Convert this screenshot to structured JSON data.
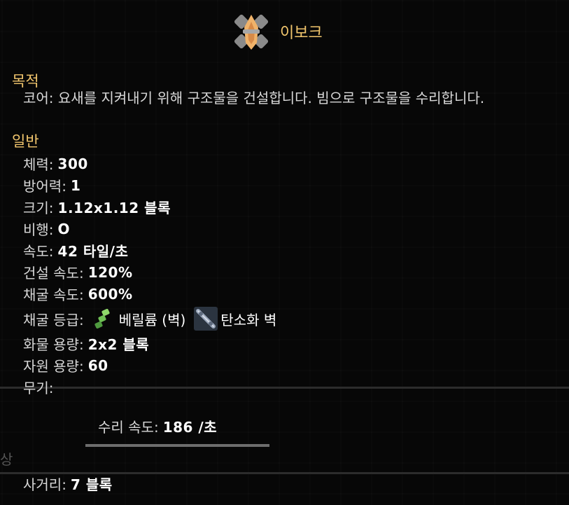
{
  "unit": {
    "name": "이보크",
    "icon": "evoke-unit-icon"
  },
  "purpose": {
    "heading": "목적",
    "text": "코어: 요새를 지켜내기 위해 구조물을 건설합니다. 빔으로 구조물을 수리합니다."
  },
  "general": {
    "heading": "일반",
    "health": {
      "label": "체력:",
      "value": "300"
    },
    "armor": {
      "label": "방어력:",
      "value": "1"
    },
    "size": {
      "label": "크기:",
      "value": "1.12x1.12 블록"
    },
    "flying": {
      "label": "비행:",
      "value": "O"
    },
    "speed": {
      "label": "속도:",
      "value": "42 타일/초"
    },
    "build_speed": {
      "label": "건설 속도:",
      "value": "120%"
    },
    "mine_speed": {
      "label": "채굴 속도:",
      "value": "600%"
    },
    "mine_tier": {
      "label": "채굴 등급:",
      "items": [
        {
          "name": "베릴륨 (벽)",
          "icon": "beryllium-wall-icon"
        },
        {
          "name": "탄소화 벽",
          "icon": "tungsten-wall-icon"
        }
      ]
    },
    "item_capacity": {
      "label": "화물 용량:",
      "value": "2x2 블록"
    },
    "resource_capacity": {
      "label": "자원 용량:",
      "value": "60"
    },
    "weapons": {
      "label": "무기:"
    }
  },
  "weapon": {
    "repair_speed": {
      "label": "수리 속도:",
      "value": "186 /초"
    }
  },
  "edge_label": "상",
  "range": {
    "label": "사거리:",
    "value": "7 블록"
  },
  "colors": {
    "heading": "#f2c66d",
    "text": "#d8d8d8",
    "value": "#ffffff"
  }
}
